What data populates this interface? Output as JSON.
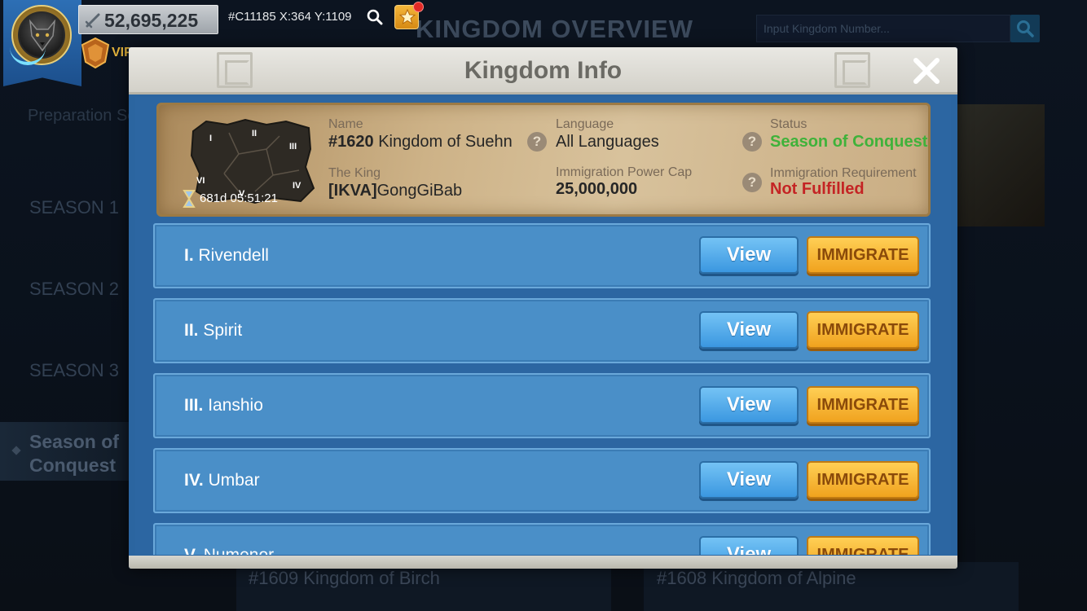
{
  "background": {
    "title": "KINGDOM OVERVIEW",
    "search_placeholder": "Input Kingdom Number...",
    "menu": {
      "preparation": "Preparation Season",
      "season1": "SEASON 1",
      "season2": "SEASON 2",
      "season3": "SEASON 3",
      "season_of_conquest": "Season of Conquest"
    },
    "kingdom_cards": [
      "#1609 Kingdom of Birch",
      "#1608 Kingdom of Alpine"
    ]
  },
  "hud": {
    "power": "52,695,225",
    "vip_label": "VIP",
    "coords": "#C11185 X:364 Y:1109"
  },
  "modal": {
    "title": "Kingdom Info",
    "info": {
      "map_regions": [
        "I",
        "II",
        "III",
        "IV",
        "V",
        "VI"
      ],
      "timer": "681d 05:51:21",
      "name_label": "Name",
      "name_number": "#1620",
      "name_value": "Kingdom of Suehn",
      "king_label": "The King",
      "king_tag": "[IKVA]",
      "king_name": "GongGiBab",
      "language_label": "Language",
      "language_value": "All Languages",
      "power_cap_label": "Immigration Power Cap",
      "power_cap_value": "25,000,000",
      "status_label": "Status",
      "status_value": "Season of Conquest",
      "requirement_label": "Immigration Requirement",
      "requirement_value": "Not Fulfilled"
    },
    "regions": [
      {
        "numeral": "I.",
        "name": "Rivendell"
      },
      {
        "numeral": "II.",
        "name": "Spirit"
      },
      {
        "numeral": "III.",
        "name": "Ianshio"
      },
      {
        "numeral": "IV.",
        "name": "Umbar"
      },
      {
        "numeral": "V.",
        "name": "Numenor"
      }
    ],
    "view_label": "View",
    "immigrate_label": "IMMIGRATE"
  },
  "colors": {
    "status_green": "#3fb23a",
    "requirement_red": "#c42424",
    "view_blue": "#3b97e0",
    "immigrate_orange": "#f0a21e"
  }
}
